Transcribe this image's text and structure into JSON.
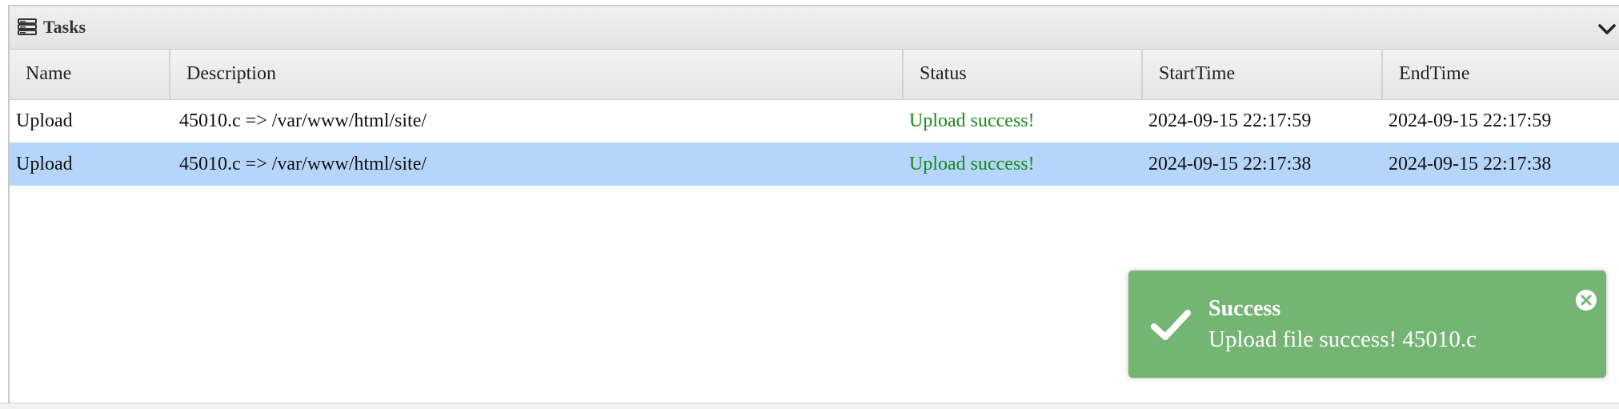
{
  "panel": {
    "title": "Tasks",
    "icon": "tasks-icon",
    "collapse_icon": "chevron-down-icon"
  },
  "table": {
    "columns": [
      "Name",
      "Description",
      "Status",
      "StartTime",
      "EndTime"
    ],
    "rows": [
      {
        "name": "Upload",
        "description": "45010.c => /var/www/html/site/",
        "status": "Upload success!",
        "start_time": "2024-09-15 22:17:59",
        "end_time": "2024-09-15 22:17:59",
        "selected": false
      },
      {
        "name": "Upload",
        "description": "45010.c => /var/www/html/site/",
        "status": "Upload success!",
        "start_time": "2024-09-15 22:17:38",
        "end_time": "2024-09-15 22:17:38",
        "selected": true
      }
    ]
  },
  "toast": {
    "title": "Success",
    "message": "Upload file success! 45010.c",
    "icon": "check-icon",
    "close_icon": "close-icon"
  },
  "colors": {
    "status_success": "#1a8a1a",
    "selected_row": "#b5d5fb",
    "toast_background": "#74b574"
  }
}
